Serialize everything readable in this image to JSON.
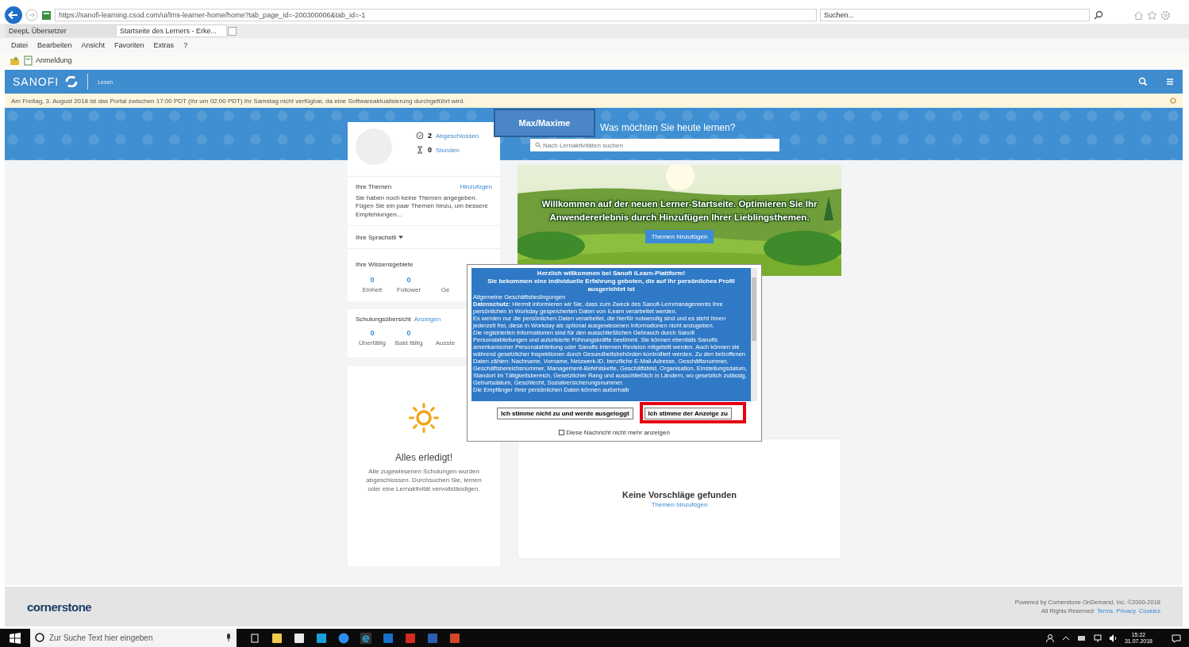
{
  "browser": {
    "address": "https://sanofi-learning.csod.com/ui/lms-learner-home/home?tab_page_id=-200300006&tab_id=-1",
    "search_placeholder": "Suchen...",
    "tabs": [
      {
        "label": "DeepL Übersetzer",
        "selected": false
      },
      {
        "label": "Startseite des Lerners - Erke...",
        "selected": true
      }
    ],
    "menu": [
      "Datei",
      "Bearbeiten",
      "Ansicht",
      "Favoriten",
      "Extras",
      "?"
    ],
    "favorites": [
      "Anmeldung"
    ]
  },
  "site_header": {
    "logo": "SANOFI",
    "section": "Lesen"
  },
  "notice": "Am Freitag, 3. August 2018 ist das Portal zwischen 17:00 PDT (Ihr um 02:00 PDT) Ihr Samstag nicht verfügbar, da eine Softwareaktualisierung durchgeführt wird.",
  "hero": {
    "heading": "Was möchten Sie heute lernen?",
    "search_placeholder": "Nach Lernaktivitäten suchen"
  },
  "overlay_label": "Max/Maxime",
  "profile": {
    "stats": [
      {
        "value": "2",
        "label": "Abgeschlossen"
      },
      {
        "value": "0",
        "label": "Stunden"
      }
    ]
  },
  "topics": {
    "title": "Ihre Themen",
    "action": "Hinzufügen",
    "text": "Sie haben noch keine Themen angegeben. Fügen Sie ein paar Themen hinzu, um bessere Empfehlungen..."
  },
  "language": "Ihre Sprachstil",
  "knowledge": {
    "title": "Ihre Wissensgebiete",
    "stats": [
      {
        "value": "0",
        "label": "Einheit"
      },
      {
        "value": "0",
        "label": "Follower"
      },
      {
        "label": "Ge"
      }
    ]
  },
  "training": {
    "title": "Schulungsübersicht",
    "action": "Anzeigen",
    "stats": [
      {
        "value": "0",
        "label": "Überfällig"
      },
      {
        "value": "0",
        "label": "Bald fällig"
      },
      {
        "label": "Ausste"
      }
    ]
  },
  "done": {
    "title": "Alles erledigt!",
    "text": "Alle zugewiesenen Schulungen wurden abgeschlossen. Durchsuchen Sie, lernen oder eine Lernaktivität vervollständigen."
  },
  "banner": {
    "text": "Willkommen auf der neuen Lerner-Startseite. Optimieren Sie Ihr Anwendererlebnis durch Hinzufügen Ihrer Lieblingsthemen.",
    "button": "Themen hinzufügen"
  },
  "suggestions": {
    "title": "Keine Vorschläge gefunden",
    "link": "Themen hinzufügen"
  },
  "dialog": {
    "title": "Herzlich willkommen bei Sanofi iLearn-Plattform!",
    "subtitle": "Sie bekommen eine individuelle Erfahrung geboten, die auf Ihr persönliches Profil ausgerichtet ist",
    "body": [
      "Allgemeine Geschäftsbedingungen",
      "**Datenschutz:** Hiermit informieren wir Sie, dass zum Zweck des Sanofi-Lernmanagements Ihre persönlichen in Workday gespeicherten Daten von iLearn verarbeitet werden.",
      "Es werden nur die persönlichen Daten verarbeitet, die hierfür notwendig sind und es steht Ihnen jederzeit frei, diese in Workday als optional ausgewiesenen Informationen nicht anzugeben.",
      "Die registrierten Informationen sind für den ausschließlichen Gebrauch durch Sanofi Personalabteilungen und autorisierte Führungskräfte bestimmt. Sie können ebenfalls Sanofis amerikanischer Personalabteilung oder Sanofis Internen Revision mitgeteilt werden. Auch können sie während gesetzlicher Inspektionen durch Gesundheitsbehörden kontrolliert werden. Zu den betroffenen Daten zählen: Nachname, Vorname, Netzwerk-ID, berufliche E-Mail-Adresse, Geschäftsnummer, Geschäftsbereichsnummer, Management-Befehlskette, Geschäftsfeld, Organisation, Einstellungsdatum, Standort im Tätigkeitsbereich, Gesetzlicher Rang und ausschließlich in Ländern, wo gesetzlich zulässig, Geburtsdatum, Geschlecht, Sozialversicherungsnummer.",
      "Die Empfänger Ihrer persönlichen Daten können außerhalb"
    ],
    "buttons": [
      "Ich stimme nicht zu und werde ausgeloggt",
      "Ich stimme der Anzeige zu"
    ],
    "checkbox": {
      "label": "Diese Nachricht nicht mehr anzeigen",
      "checked": false
    }
  },
  "footer": {
    "logo": "cornerstone",
    "powered": "Powered by Cornerstone OnDemand, Inc. ©2000-2018",
    "rights": "All Rights Reserved",
    "links": [
      "Terms",
      "Privacy",
      "Cookies"
    ]
  },
  "taskbar": {
    "search_placeholder": "Zur Suche Text hier eingeben",
    "time": "15:22",
    "date": "31.07.2018"
  }
}
